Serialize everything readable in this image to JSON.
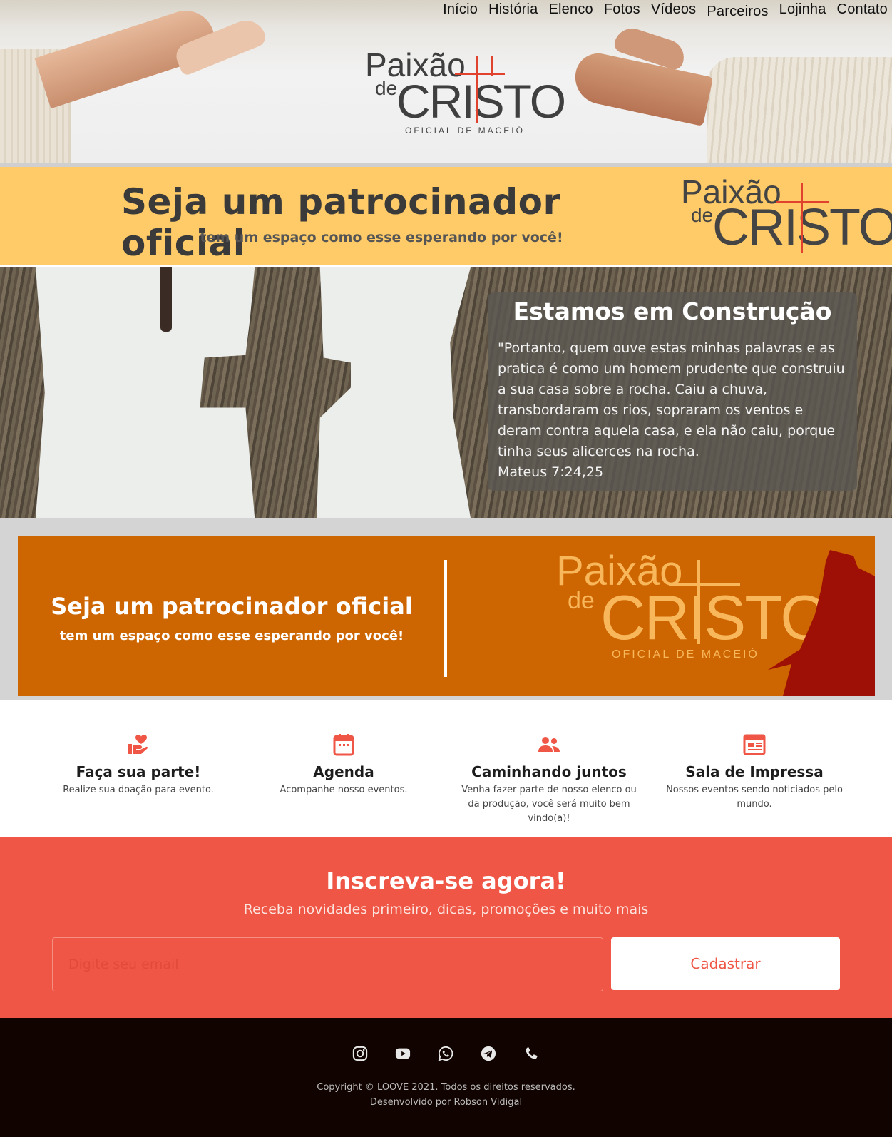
{
  "nav": {
    "items": [
      "Início",
      "História",
      "Elenco",
      "Fotos",
      "Vídeos",
      "Parceiros",
      "Lojinha",
      "Contato"
    ]
  },
  "logo": {
    "paixao": "Paixão",
    "de": "de",
    "cristo": "CRISTO",
    "subtitle": "OFICIAL DE MACEIÓ"
  },
  "sponsor_yellow": {
    "title": "Seja um patrocinador oficial",
    "subtitle": "tem um espaço como esse esperando por você!"
  },
  "construction": {
    "title": "Estamos em Construção",
    "quote": "\"Portanto, quem ouve estas minhas palavras e as pratica é como um homem prudente que construiu a sua casa sobre a rocha. Caiu a chuva, transbordaram os rios, sopraram os ventos e deram contra aquela casa, e ela não caiu, porque tinha seus alicerces na rocha.",
    "reference": "Mateus 7:24,25"
  },
  "sponsor_orange": {
    "title": "Seja um patrocinador oficial",
    "subtitle": "tem um espaço como esse esperando por você!"
  },
  "features": [
    {
      "icon": "hand-heart-icon",
      "title": "Faça sua parte!",
      "text": "Realize sua doação para evento."
    },
    {
      "icon": "calendar-icon",
      "title": "Agenda",
      "text": "Acompanhe nosso eventos."
    },
    {
      "icon": "people-icon",
      "title": "Caminhando juntos",
      "text": "Venha fazer parte de nosso elenco ou da produção, você será muito bem vindo(a)!"
    },
    {
      "icon": "newspaper-icon",
      "title": "Sala de Impressa",
      "text": "Nossos eventos sendo noticiados pelo mundo."
    }
  ],
  "newsletter": {
    "title": "Inscreva-se agora!",
    "subtitle": "Receba novidades primeiro, dicas, promoções e muito mais",
    "placeholder": "Digite seu email",
    "button": "Cadastrar"
  },
  "footer": {
    "socials": [
      "instagram-icon",
      "youtube-icon",
      "whatsapp-icon",
      "telegram-icon",
      "phone-icon"
    ],
    "copyright": "Copyright © LOOVE 2021. Todos os direitos reservados.",
    "developer": "Desenvolvido por Robson Vidigal"
  },
  "colors": {
    "accent_red": "#ef5646",
    "sponsor_yellow": "#fecb68",
    "sponsor_orange": "#cd6500",
    "footer_bg": "#100300",
    "cross_red": "#e0422e"
  }
}
